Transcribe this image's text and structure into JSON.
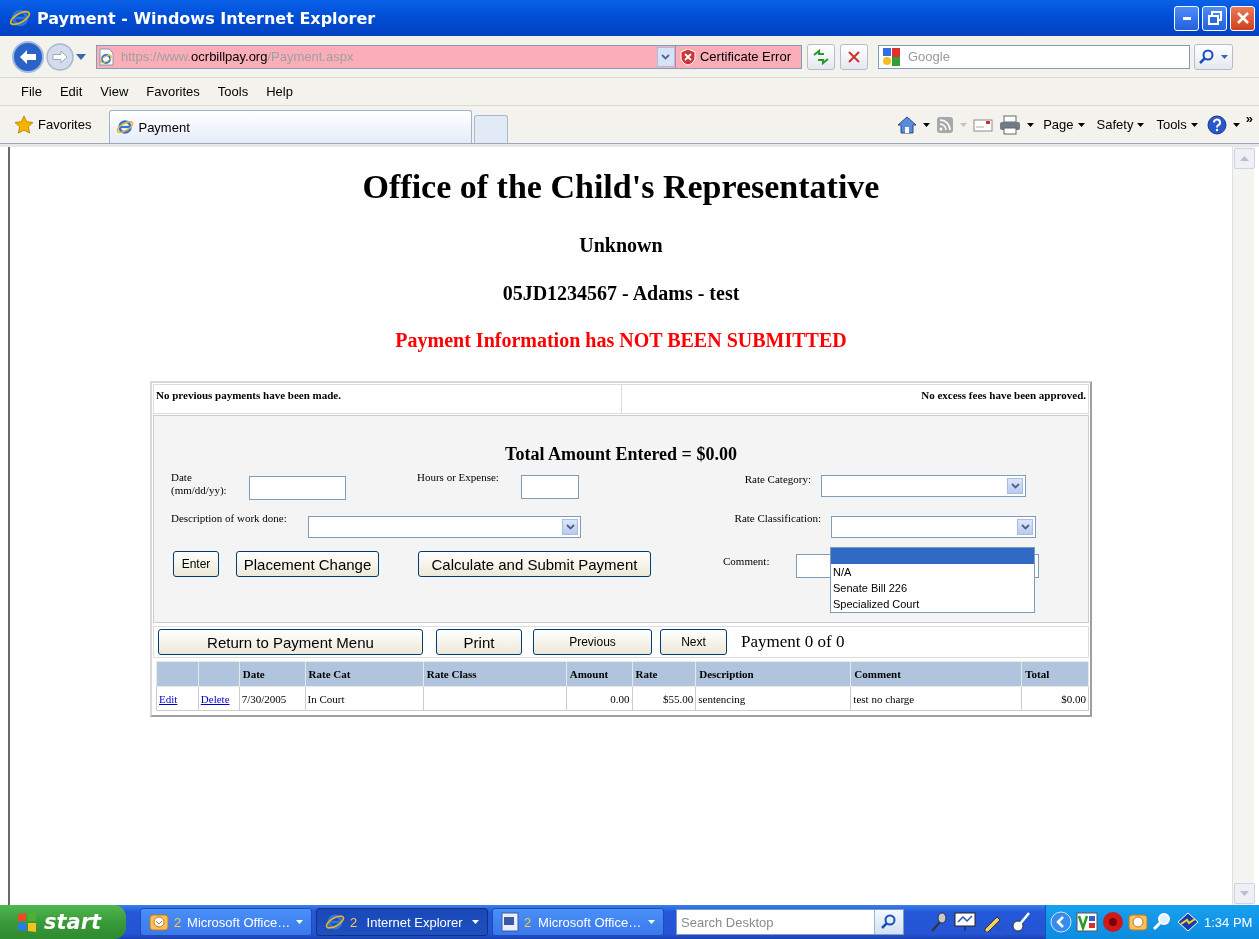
{
  "window": {
    "title": "Payment - Windows Internet Explorer"
  },
  "address_bar": {
    "url_parts": [
      {
        "text": "https://www.",
        "emphasis": false
      },
      {
        "text": "ocrbillpay.org",
        "emphasis": true
      },
      {
        "text": "/Payment.aspx",
        "emphasis": false
      }
    ],
    "certificate_status": "Certificate Error"
  },
  "search": {
    "placeholder": "Google"
  },
  "menu": [
    "File",
    "Edit",
    "View",
    "Favorites",
    "Tools",
    "Help"
  ],
  "favorites": "Favorites",
  "tabs": [
    {
      "label": "Payment",
      "selected": true
    }
  ],
  "command_bar": {
    "menus": [
      "Page",
      "Safety",
      "Tools"
    ],
    "overflow": "»"
  },
  "page": {
    "title": "Office of the Child's Representative",
    "subtitle": "Unknown",
    "case": "05JD1234567 - Adams - test",
    "status": "Payment Information has NOT BEEN SUBMITTED",
    "notices": [
      "No previous payments have been made.",
      "No excess fees have been approved."
    ],
    "total": "Total Amount Entered = $0.00",
    "date": {
      "label": "Date (mm/dd/yy):"
    },
    "hours": {
      "label": "Hours or Expense:"
    },
    "rate_category": {
      "label": "Rate Category:"
    },
    "description": {
      "label": "Description of work done:"
    },
    "rate_classification": {
      "label": "Rate Classification:",
      "expanded": true,
      "blank_option_selected": true,
      "options": [
        {
          "label": "N/A",
          "selected": false
        },
        {
          "label": "Senate Bill 226",
          "selected": false
        },
        {
          "label": "Specialized Court",
          "selected": false
        }
      ]
    },
    "comment": {
      "label": "Comment:"
    },
    "form_buttons": [
      "Enter",
      "Placement Change",
      "Calculate and Submit Payment"
    ],
    "nav_buttons": [
      "Return to Payment Menu",
      "Print",
      "Previous",
      "Next"
    ],
    "counter": "Payment 0 of 0",
    "table": {
      "columns": [
        {
          "label": "Date",
          "kind": "text"
        },
        {
          "label": "Rate Cat",
          "kind": "text"
        },
        {
          "label": "Rate Class",
          "kind": "text"
        },
        {
          "label": "Amount",
          "kind": "number"
        },
        {
          "label": "Rate",
          "kind": "number"
        },
        {
          "label": "Description",
          "kind": "text"
        },
        {
          "label": "Comment",
          "kind": "text"
        },
        {
          "label": "Total",
          "kind": "number"
        }
      ],
      "rows": [
        {
          "actions": [
            "Edit",
            "Delete"
          ],
          "cells": [
            "7/30/2005",
            "In Court",
            null,
            "0.00",
            "$55.00",
            "sentencing",
            "test no charge",
            "$0.00"
          ]
        }
      ]
    }
  },
  "taskbar": {
    "start": "start",
    "tasks": [
      {
        "kind": "outlook",
        "count": "2",
        "label": "Microsoft Office…",
        "selected": false
      },
      {
        "kind": "ie",
        "count": "2",
        "label": "Internet Explorer",
        "selected": true
      },
      {
        "kind": "word",
        "count": "2",
        "label": "Microsoft Office…",
        "selected": false
      }
    ],
    "search": {
      "placeholder": "Search Desktop"
    },
    "clock": "1:34 PM"
  }
}
